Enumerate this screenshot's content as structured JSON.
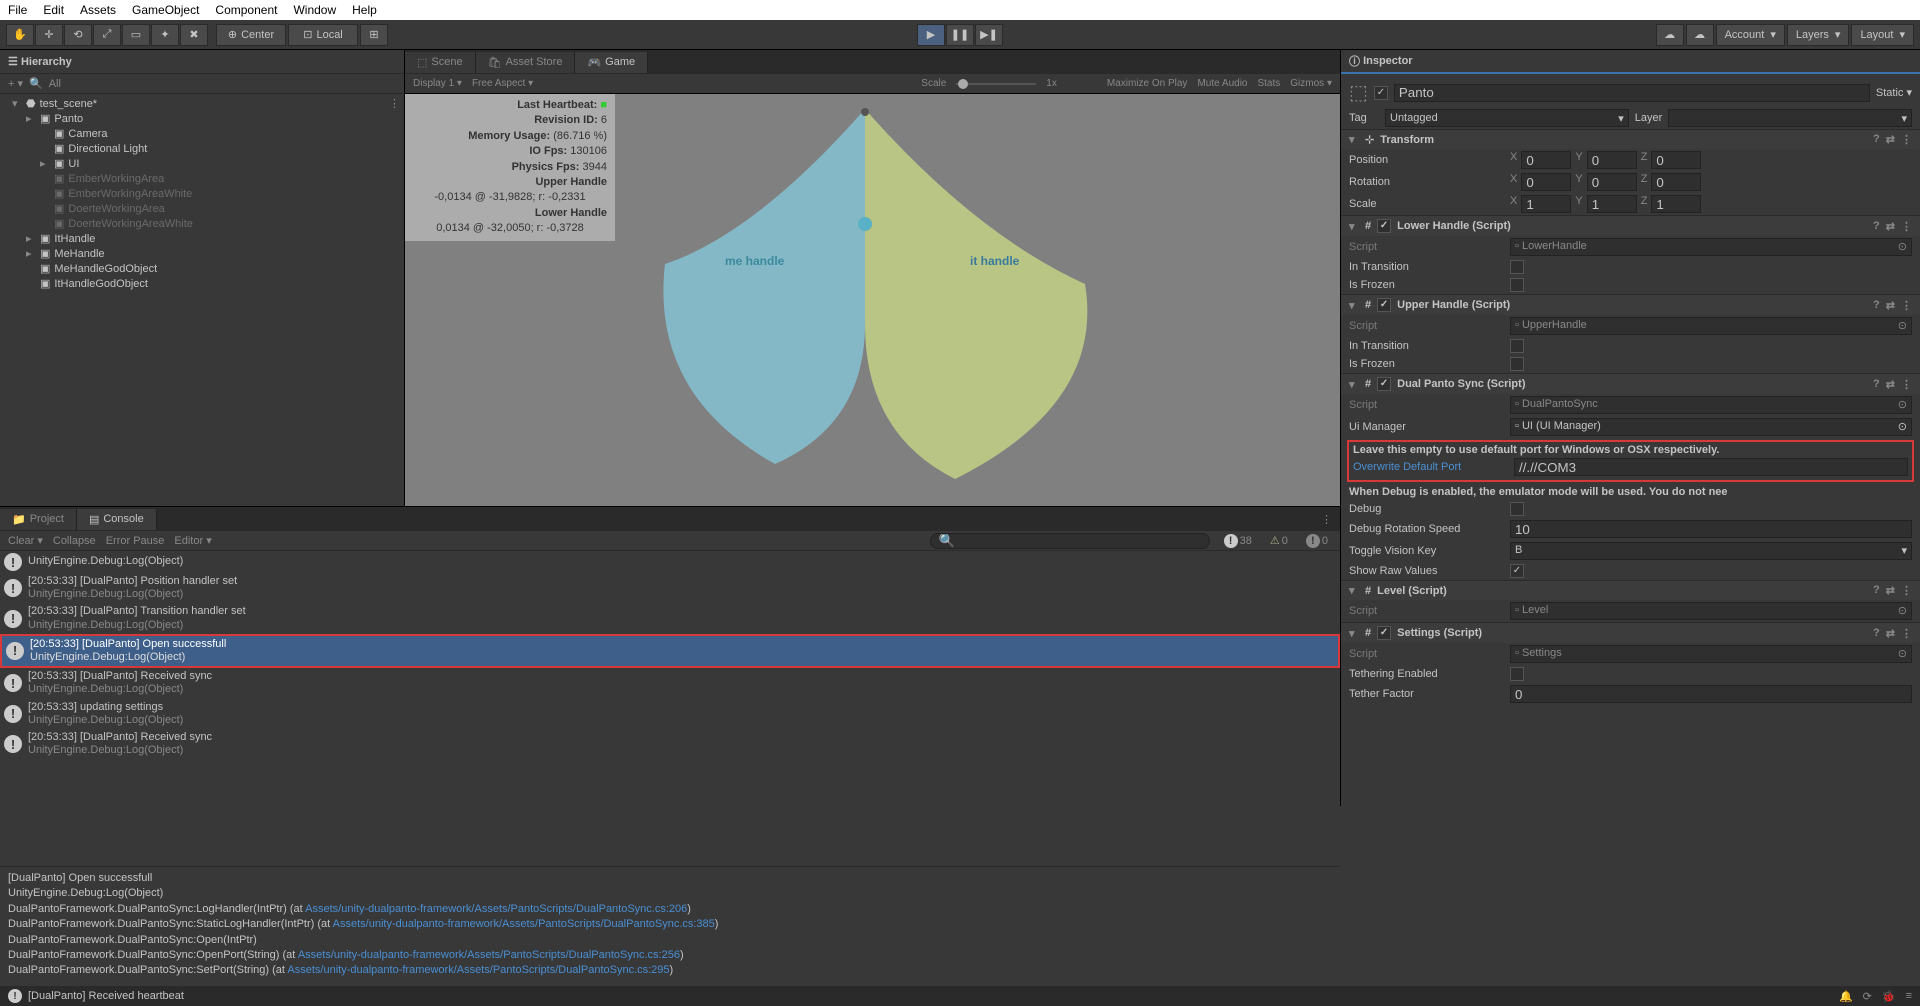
{
  "menubar": [
    "File",
    "Edit",
    "Assets",
    "GameObject",
    "Component",
    "Window",
    "Help"
  ],
  "toolbar": {
    "pivot": "Center",
    "space": "Local",
    "right": {
      "account": "Account",
      "layers": "Layers",
      "layout": "Layout"
    }
  },
  "hierarchy": {
    "title": "Hierarchy",
    "search_placeholder": "All",
    "root": "test_scene*",
    "items": [
      {
        "name": "Panto",
        "indent": 1,
        "fold": true,
        "dim": false
      },
      {
        "name": "Camera",
        "indent": 2,
        "dim": false
      },
      {
        "name": "Directional Light",
        "indent": 2,
        "dim": false
      },
      {
        "name": "UI",
        "indent": 2,
        "fold": true,
        "dim": false
      },
      {
        "name": "EmberWorkingArea",
        "indent": 2,
        "dim": true
      },
      {
        "name": "EmberWorkingAreaWhite",
        "indent": 2,
        "dim": true
      },
      {
        "name": "DoerteWorkingArea",
        "indent": 2,
        "dim": true
      },
      {
        "name": "DoerteWorkingAreaWhite",
        "indent": 2,
        "dim": true
      },
      {
        "name": "ItHandle",
        "indent": 1,
        "fold": true,
        "dim": false
      },
      {
        "name": "MeHandle",
        "indent": 1,
        "fold": true,
        "dim": false
      },
      {
        "name": "MeHandleGodObject",
        "indent": 1,
        "dim": false
      },
      {
        "name": "ItHandleGodObject",
        "indent": 1,
        "dim": false
      }
    ]
  },
  "tabs": {
    "scene": "Scene",
    "asset_store": "Asset Store",
    "game": "Game"
  },
  "game_toolbar": {
    "display": "Display 1",
    "aspect": "Free Aspect",
    "scale_label": "Scale",
    "scale_val": "1x",
    "maximize": "Maximize On Play",
    "mute": "Mute Audio",
    "stats": "Stats",
    "gizmos": "Gizmos"
  },
  "stats": {
    "heartbeat_lbl": "Last Heartbeat:",
    "revision_lbl": "Revision ID:",
    "revision": "6",
    "mem_lbl": "Memory Usage:",
    "mem": "(86.716 %)",
    "iofps_lbl": "IO Fps:",
    "iofps": "130106",
    "physfps_lbl": "Physics Fps:",
    "physfps": "3944",
    "upper_lbl": "Upper Handle",
    "upper": "-0,0134 @ -31,9828; r: -0,2331",
    "lower_lbl": "Lower Handle",
    "lower": "0,0134 @ -32,0050; r: -0,3728"
  },
  "game_labels": {
    "me": "me handle",
    "it": "it handle"
  },
  "bottom_tabs": {
    "project": "Project",
    "console": "Console"
  },
  "console": {
    "clear": "Clear",
    "collapse": "Collapse",
    "error_pause": "Error Pause",
    "editor": "Editor",
    "count_info": "38",
    "count_warn": "0",
    "count_err": "0",
    "items": [
      {
        "main": "UnityEngine.Debug:Log(Object)",
        "sub": ""
      },
      {
        "main": "[20:53:33] [DualPanto] Position handler set",
        "sub": "UnityEngine.Debug:Log(Object)"
      },
      {
        "main": "[20:53:33] [DualPanto] Transition handler set",
        "sub": "UnityEngine.Debug:Log(Object)"
      },
      {
        "main": "[20:53:33] [DualPanto] Open successfull",
        "sub": "UnityEngine.Debug:Log(Object)",
        "selected": true,
        "redbox": true
      },
      {
        "main": "[20:53:33] [DualPanto] Received sync",
        "sub": "UnityEngine.Debug:Log(Object)"
      },
      {
        "main": "[20:53:33] updating settings",
        "sub": "UnityEngine.Debug:Log(Object)"
      },
      {
        "main": "[20:53:33] [DualPanto] Received sync",
        "sub": "UnityEngine.Debug:Log(Object)"
      }
    ],
    "detail_lines": [
      {
        "text": "[DualPanto] Open successfull"
      },
      {
        "text": "UnityEngine.Debug:Log(Object)"
      },
      {
        "text": "DualPantoFramework.DualPantoSync:LogHandler(IntPtr) (at ",
        "link": "Assets/unity-dualpanto-framework/Assets/PantoScripts/DualPantoSync.cs:206",
        "tail": ")"
      },
      {
        "text": "DualPantoFramework.DualPantoSync:StaticLogHandler(IntPtr) (at ",
        "link": "Assets/unity-dualpanto-framework/Assets/PantoScripts/DualPantoSync.cs:385",
        "tail": ")"
      },
      {
        "text": "DualPantoFramework.DualPantoSync:Open(IntPtr)"
      },
      {
        "text": "DualPantoFramework.DualPantoSync:OpenPort(String) (at ",
        "link": "Assets/unity-dualpanto-framework/Assets/PantoScripts/DualPantoSync.cs:256",
        "tail": ")"
      },
      {
        "text": "DualPantoFramework.DualPantoSync:SetPort(String) (at ",
        "link": "Assets/unity-dualpanto-framework/Assets/PantoScripts/DualPantoSync.cs:295",
        "tail": ")"
      }
    ]
  },
  "statusbar": {
    "text": "[DualPanto] Received heartbeat"
  },
  "inspector": {
    "title": "Inspector",
    "name": "Panto",
    "static_lbl": "Static",
    "tag_lbl": "Tag",
    "tag": "Untagged",
    "layer_lbl": "Layer",
    "transform": {
      "title": "Transform",
      "pos": "Position",
      "rot": "Rotation",
      "scale": "Scale",
      "px": "0",
      "py": "0",
      "pz": "0",
      "rx": "0",
      "ry": "0",
      "rz": "0",
      "sx": "1",
      "sy": "1",
      "sz": "1"
    },
    "lower_handle": {
      "title": "Lower Handle (Script)",
      "script_lbl": "Script",
      "script": "LowerHandle",
      "in_transition": "In Transition",
      "is_frozen": "Is Frozen"
    },
    "upper_handle": {
      "title": "Upper Handle (Script)",
      "script_lbl": "Script",
      "script": "UpperHandle",
      "in_transition": "In Transition",
      "is_frozen": "Is Frozen"
    },
    "dualpanto": {
      "title": "Dual Panto Sync (Script)",
      "script_lbl": "Script",
      "script": "DualPantoSync",
      "uimgr_lbl": "Ui Manager",
      "uimgr": "UI (UI Manager)",
      "help": "Leave this empty to use default port for Windows or OSX respectively.",
      "overwrite_lbl": "Overwrite Default Port",
      "overwrite_val": "//.//COM3",
      "debug_help": "When Debug is enabled, the emulator mode will be used. You do not nee",
      "debug_lbl": "Debug",
      "debug_speed_lbl": "Debug Rotation Speed",
      "debug_speed": "10",
      "toggle_key_lbl": "Toggle Vision Key",
      "toggle_key": "B",
      "show_raw_lbl": "Show Raw Values"
    },
    "level": {
      "title": "Level (Script)",
      "script_lbl": "Script",
      "script": "Level"
    },
    "settings": {
      "title": "Settings (Script)",
      "script_lbl": "Script",
      "script": "Settings",
      "teth_lbl": "Tethering Enabled",
      "teth_factor_lbl": "Tether Factor",
      "teth_factor": "0"
    }
  }
}
